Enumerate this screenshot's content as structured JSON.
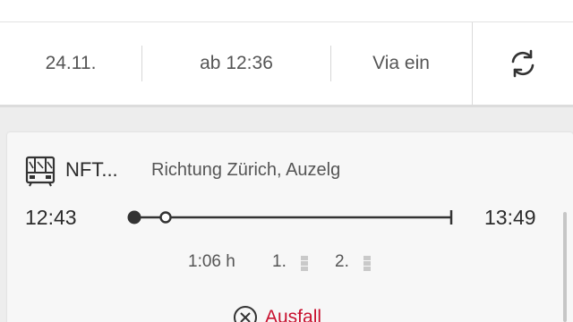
{
  "filters": {
    "date": "24.11.",
    "time": "ab 12:36",
    "via": "Via ein"
  },
  "icons": {
    "refresh": "refresh-icon",
    "train": "train-icon",
    "cancel": "cancel-circle-icon"
  },
  "connection": {
    "train_name": "NFT...",
    "direction": "Richtung Zürich, Auzelg",
    "departure": "12:43",
    "arrival": "13:49",
    "duration": "1:06 h",
    "first_class_label": "1.",
    "second_class_label": "2.",
    "status": "Ausfall"
  },
  "colors": {
    "status": "#c8102e",
    "background": "#ededed",
    "card": "#f7f7f7",
    "route_line": "#333333"
  }
}
